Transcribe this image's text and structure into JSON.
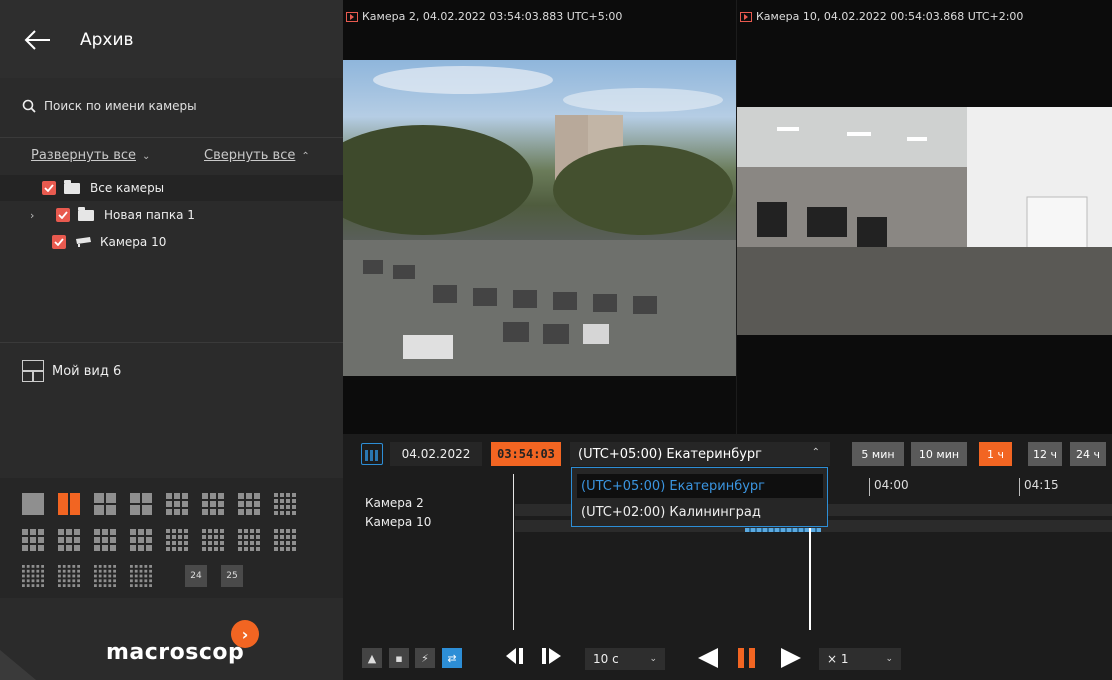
{
  "sidebar": {
    "title": "Архив",
    "search_placeholder": "Поиск по имени камеры",
    "expand_all": "Развернуть все",
    "collapse_all": "Свернуть все",
    "tree": [
      {
        "label": "Все камеры",
        "type": "folder",
        "checked": true
      },
      {
        "label": "Новая папка 1",
        "type": "folder",
        "checked": true,
        "collapsed": true
      },
      {
        "label": "Камера 10",
        "type": "camera",
        "checked": true
      }
    ],
    "view_name": "Мой вид 6",
    "layout_numbers": [
      "24",
      "25"
    ],
    "brand": "macroscop"
  },
  "cameras": [
    {
      "title": "Камера 2, 04.02.2022 03:54:03.883 UTC+5:00"
    },
    {
      "title": "Камера 10, 04.02.2022 00:54:03.868 UTC+2:00"
    }
  ],
  "toolbar": {
    "date": "04.02.2022",
    "time": "03:54:03",
    "timezone": "(UTC+05:00) Екатеринбург",
    "zoom_options": [
      "5 мин",
      "10 мин",
      "1 ч",
      "12 ч",
      "24 ч"
    ],
    "zoom_active": "1 ч"
  },
  "timezone_dropdown": {
    "options": [
      "(UTC+05:00) Екатеринбург",
      "(UTC+02:00) Калининград"
    ],
    "selected": "(UTC+05:00) Екатеринбург"
  },
  "timeline": {
    "tracks": [
      "Камера 2",
      "Камера 10"
    ],
    "ticks": [
      "04:00",
      "04:15"
    ]
  },
  "controls": {
    "step": "10 с",
    "speed": "× 1"
  },
  "colors": {
    "accent": "#f26522",
    "highlight": "#2d8ed6",
    "checkbox": "#e85a4f"
  }
}
